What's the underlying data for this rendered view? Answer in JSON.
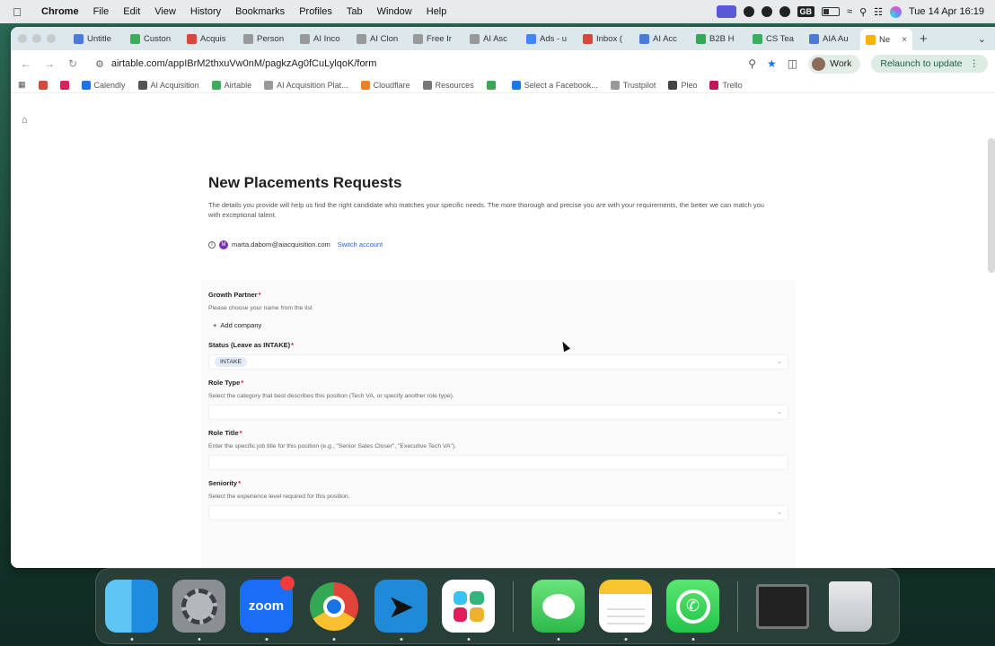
{
  "menubar": {
    "app_name": "Chrome",
    "items": [
      "File",
      "Edit",
      "View",
      "History",
      "Bookmarks",
      "Profiles",
      "Tab",
      "Window",
      "Help"
    ],
    "keyboard_layout": "GB",
    "datetime": "Tue 14 Apr  16:19"
  },
  "tabs": [
    {
      "label": "Untitle",
      "color": "#4a7bd6"
    },
    {
      "label": "Custon",
      "color": "#3cae5a"
    },
    {
      "label": "Acquis",
      "color": "#d44a3a"
    },
    {
      "label": "Person",
      "color": "#999999"
    },
    {
      "label": "AI Inco",
      "color": "#999999"
    },
    {
      "label": "AI Clon",
      "color": "#999999"
    },
    {
      "label": "Free Ir",
      "color": "#999999"
    },
    {
      "label": "AI Asc",
      "color": "#999999"
    },
    {
      "label": "Ads - u",
      "color": "#4285f4"
    },
    {
      "label": "Inbox (",
      "color": "#d44a3a"
    },
    {
      "label": "AI Acc",
      "color": "#4a7bd6"
    },
    {
      "label": "B2B H",
      "color": "#34a853"
    },
    {
      "label": "CS Tea",
      "color": "#3cae5a"
    },
    {
      "label": "AIA Au",
      "color": "#4a7bd6"
    },
    {
      "label": "Ne",
      "color": "#f4b400",
      "active": true
    }
  ],
  "toolbar": {
    "url": "airtable.com/appIBrM2thxuVw0nM/pagkzAg0fCuLylqoK/form",
    "profile_label": "Work",
    "relaunch_label": "Relaunch to update"
  },
  "bookmarks": [
    {
      "label": "Calendly",
      "color": "#1a73e8"
    },
    {
      "label": "AI Acquisition",
      "color": "#555555"
    },
    {
      "label": "Airtable",
      "color": "#3cae5a"
    },
    {
      "label": "AI Acquisition Plat...",
      "color": "#999999"
    },
    {
      "label": "Cloudflare",
      "color": "#f38020"
    },
    {
      "label": "Resources",
      "color": "#777777"
    },
    {
      "label": "",
      "color": "#34a853"
    },
    {
      "label": "Select a Facebook...",
      "color": "#1877f2"
    },
    {
      "label": "Trustpilot",
      "color": "#999999"
    },
    {
      "label": "Pleo",
      "color": "#444444"
    },
    {
      "label": "Trello",
      "color": "#c2185b"
    }
  ],
  "form": {
    "title": "New Placements Requests",
    "description": "The details you provide will help us find the right candidate who matches your specific needs. The more thorough and precise you are with your requirements, the better we can match you with exceptional talent.",
    "account_initial": "M",
    "account_email": "marta.daborn@aiacquisition.com",
    "switch_account": "Switch account",
    "fields": {
      "growth_partner": {
        "label": "Growth Partner",
        "help": "Please choose your name from the list",
        "add_button": "Add company"
      },
      "status": {
        "label": "Status (Leave as INTAKE)",
        "value": "INTAKE"
      },
      "role_type": {
        "label": "Role Type",
        "help": "Select the category that best describes this position (Tech VA, or specify another role type)."
      },
      "role_title": {
        "label": "Role Title",
        "help": "Enter the specific job title for this position (e.g., \"Senior Sales Closer\", \"Executive Tech VA\")."
      },
      "seniority": {
        "label": "Seniority",
        "help": "Select the experience level required for this position."
      }
    }
  },
  "dock": {
    "zoom_label": "zoom",
    "apps": [
      "Finder",
      "System Settings",
      "Zoom",
      "Google Chrome",
      "Arrow",
      "Slack",
      "Messages",
      "Notes",
      "WhatsApp",
      "Screen",
      "Trash"
    ]
  }
}
